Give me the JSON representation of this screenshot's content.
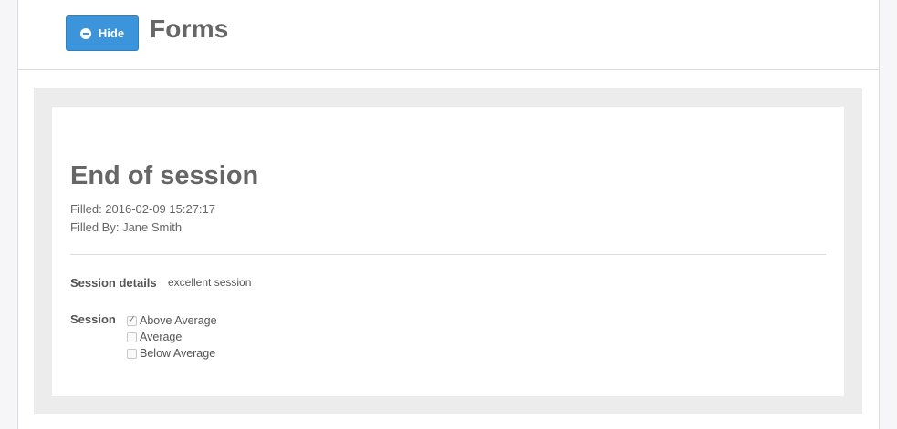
{
  "header": {
    "hide_label": "Hide",
    "title": "Forms"
  },
  "form": {
    "title": "End of session",
    "filled": "Filled: 2016-02-09 15:27:17",
    "filled_by": "Filled By: Jane Smith",
    "fields": {
      "session_details": {
        "label": "Session details",
        "value": "excellent session"
      },
      "session": {
        "label": "Session",
        "options": [
          {
            "label": "Above Average",
            "checked": true
          },
          {
            "label": "Average",
            "checked": false
          },
          {
            "label": "Below Average",
            "checked": false
          }
        ]
      }
    }
  },
  "colors": {
    "accent": "#3c95db",
    "text": "#666666",
    "form_bg": "#ececec"
  }
}
